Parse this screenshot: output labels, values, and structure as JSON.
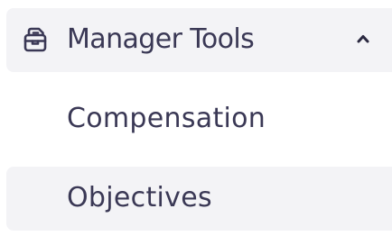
{
  "nav": {
    "section": {
      "label": "Manager Tools",
      "icon": "toolbox-icon",
      "expanded": true,
      "toggle_icon": "chevron-up-icon"
    },
    "items": [
      {
        "label": "Compensation",
        "active": false
      },
      {
        "label": "Objectives",
        "active": true
      }
    ]
  },
  "colors": {
    "text": "#3a3855",
    "highlight_background": "#f3f3f6",
    "background": "#ffffff"
  }
}
